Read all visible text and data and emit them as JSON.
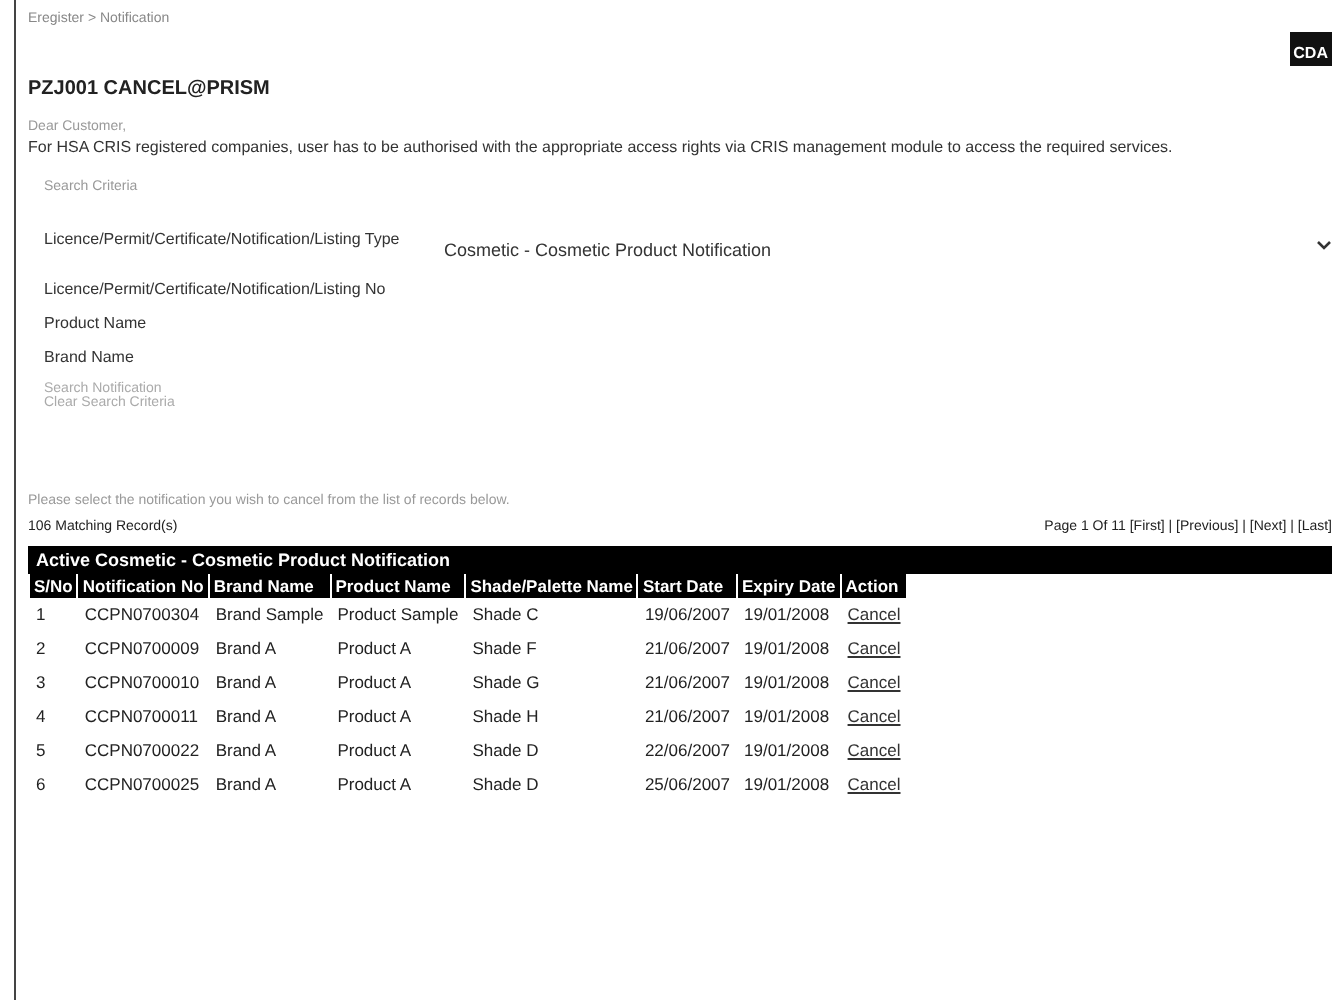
{
  "breadcrumb": "Eregister > Notification",
  "logo": "CDA",
  "page_title": "PZJ001 CANCEL@PRISM",
  "intro_heading": "Dear Customer,",
  "intro_text": "For HSA CRIS registered companies, user has to be authorised with the appropriate access rights via CRIS management module to access the required services.",
  "section_label": "Search Criteria",
  "form": [
    {
      "label": "Licence/Permit/Certificate/Notification/Listing Type",
      "kind": "select",
      "value": "Cosmetic - Cosmetic Product Notification"
    },
    {
      "label": "Licence/Permit/Certificate/Notification/Listing No",
      "kind": "text"
    },
    {
      "label": "Product Name",
      "kind": "text"
    },
    {
      "label": "Brand Name",
      "kind": "text"
    }
  ],
  "search_links": [
    "Search Notification",
    "Clear Search Criteria"
  ],
  "instruction": "Please select the notification you wish to cancel from the list of records below.",
  "record_count": "106 Matching Record(s)",
  "pager": "Page 1 Of 11 [First] | [Previous] | [Next] | [Last]",
  "table": {
    "caption": "Active Cosmetic - Cosmetic Product Notification",
    "columns": [
      "S/No",
      "Notification No",
      "Brand Name",
      "Product Name",
      "Shade/Palette Name",
      "Start Date",
      "Expiry Date",
      "Action"
    ],
    "rows": [
      [
        "1",
        "CCPN0700304",
        "Brand Sample",
        "Product Sample",
        "Shade C",
        "19/06/2007",
        "19/01/2008",
        "Cancel"
      ],
      [
        "2",
        "CCPN0700009",
        "Brand A",
        "Product A",
        "Shade F",
        "21/06/2007",
        "19/01/2008",
        "Cancel"
      ],
      [
        "3",
        "CCPN0700010",
        "Brand A",
        "Product A",
        "Shade G",
        "21/06/2007",
        "19/01/2008",
        "Cancel"
      ],
      [
        "4",
        "CCPN0700011",
        "Brand A",
        "Product A",
        "Shade H",
        "21/06/2007",
        "19/01/2008",
        "Cancel"
      ],
      [
        "5",
        "CCPN0700022",
        "Brand A",
        "Product A",
        "Shade D",
        "22/06/2007",
        "19/01/2008",
        "Cancel"
      ],
      [
        "6",
        "CCPN0700025",
        "Brand A",
        "Product A",
        "Shade D",
        "25/06/2007",
        "19/01/2008",
        "Cancel"
      ]
    ]
  }
}
